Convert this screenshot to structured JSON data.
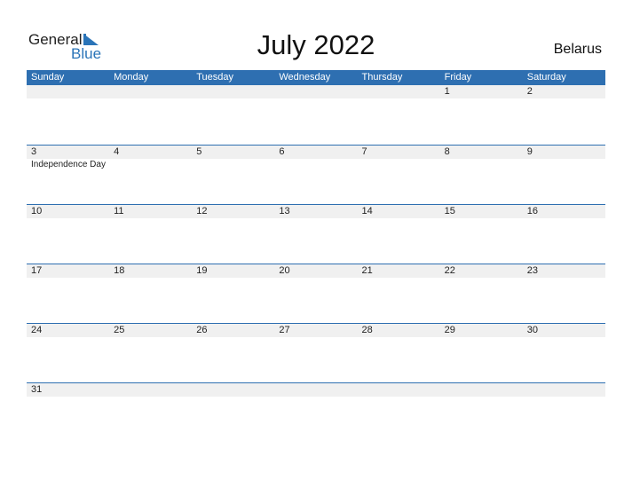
{
  "logo": {
    "line1": "General",
    "line2": "Blue"
  },
  "title": "July 2022",
  "country": "Belarus",
  "weekdays": [
    "Sunday",
    "Monday",
    "Tuesday",
    "Wednesday",
    "Thursday",
    "Friday",
    "Saturday"
  ],
  "weeks": [
    [
      {
        "d": ""
      },
      {
        "d": ""
      },
      {
        "d": ""
      },
      {
        "d": ""
      },
      {
        "d": ""
      },
      {
        "d": "1"
      },
      {
        "d": "2"
      }
    ],
    [
      {
        "d": "3",
        "h": "Independence Day"
      },
      {
        "d": "4"
      },
      {
        "d": "5"
      },
      {
        "d": "6"
      },
      {
        "d": "7"
      },
      {
        "d": "8"
      },
      {
        "d": "9"
      }
    ],
    [
      {
        "d": "10"
      },
      {
        "d": "11"
      },
      {
        "d": "12"
      },
      {
        "d": "13"
      },
      {
        "d": "14"
      },
      {
        "d": "15"
      },
      {
        "d": "16"
      }
    ],
    [
      {
        "d": "17"
      },
      {
        "d": "18"
      },
      {
        "d": "19"
      },
      {
        "d": "20"
      },
      {
        "d": "21"
      },
      {
        "d": "22"
      },
      {
        "d": "23"
      }
    ],
    [
      {
        "d": "24"
      },
      {
        "d": "25"
      },
      {
        "d": "26"
      },
      {
        "d": "27"
      },
      {
        "d": "28"
      },
      {
        "d": "29"
      },
      {
        "d": "30"
      }
    ],
    [
      {
        "d": "31"
      },
      {
        "d": ""
      },
      {
        "d": ""
      },
      {
        "d": ""
      },
      {
        "d": ""
      },
      {
        "d": ""
      },
      {
        "d": ""
      }
    ]
  ],
  "colors": {
    "accent": "#2e6fb1",
    "band": "#f0f0f0"
  }
}
